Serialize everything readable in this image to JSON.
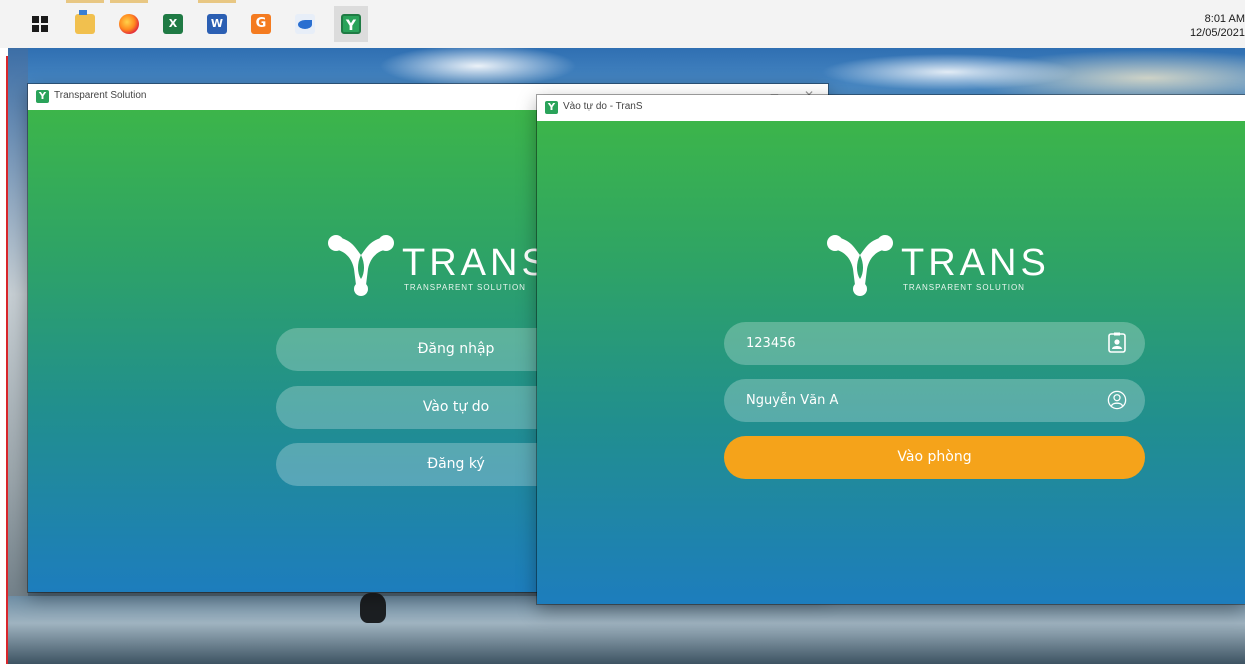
{
  "taskbar": {
    "apps": [
      {
        "name": "start-button",
        "icon": "windows-icon"
      },
      {
        "name": "file-explorer",
        "icon": "folder-icon"
      },
      {
        "name": "firefox",
        "icon": "firefox-icon"
      },
      {
        "name": "excel",
        "icon": "excel-icon",
        "glyph": "X"
      },
      {
        "name": "word",
        "icon": "word-icon",
        "glyph": "W"
      },
      {
        "name": "app-g",
        "icon": "g-app-icon",
        "glyph": "G"
      },
      {
        "name": "app-blue",
        "icon": "blue-app-icon"
      },
      {
        "name": "trans",
        "icon": "trans-app-icon",
        "glyph": "Y"
      }
    ],
    "clock_time": "8:01 AM",
    "clock_date": "12/05/2021"
  },
  "window_back": {
    "title": "Transparent Solution",
    "logo_word": "TRANS",
    "logo_sub": "TRANSPARENT SOLUTION",
    "buttons": {
      "login": "Đăng nhập",
      "guest": "Vào tự do",
      "register": "Đăng ký"
    }
  },
  "window_front": {
    "title": "Vào tự do - TranS",
    "logo_word": "TRANS",
    "logo_sub": "TRANSPARENT SOLUTION",
    "room_id": "123456",
    "display_name": "Nguyễn Văn A",
    "enter_button": "Vào phòng"
  },
  "colors": {
    "gradient_top": "#3cb54a",
    "gradient_bottom": "#1d7dbd",
    "primary_button": "#f5a31a"
  }
}
